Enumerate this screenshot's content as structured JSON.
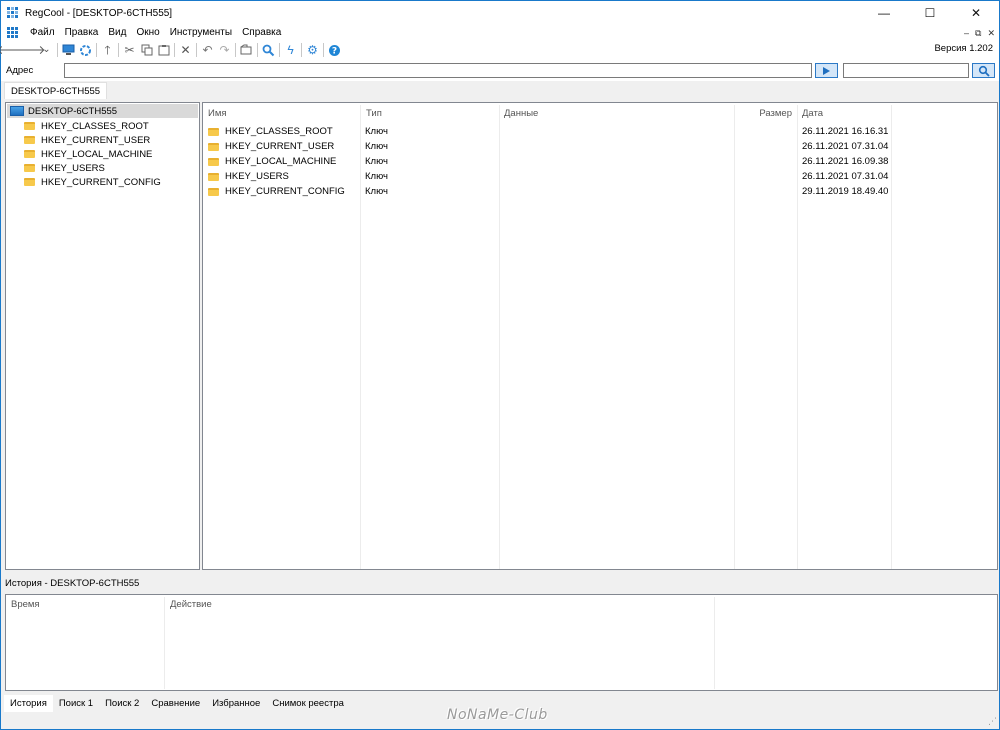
{
  "window": {
    "title": "RegCool - [DESKTOP-6CTH555]",
    "minimize": "—",
    "maximize": "☐",
    "close": "✕"
  },
  "menu": {
    "items": [
      "Файл",
      "Правка",
      "Вид",
      "Окно",
      "Инструменты",
      "Справка"
    ],
    "mdi_min": "–",
    "mdi_restore": "⧉",
    "mdi_close": "✕"
  },
  "toolbar": {
    "version": "Версия 1.202"
  },
  "address": {
    "label": "Адрес",
    "value": "",
    "search_value": ""
  },
  "tab": {
    "label": "DESKTOP-6CTH555"
  },
  "tree": {
    "root": "DESKTOP-6CTH555",
    "items": [
      "HKEY_CLASSES_ROOT",
      "HKEY_CURRENT_USER",
      "HKEY_LOCAL_MACHINE",
      "HKEY_USERS",
      "HKEY_CURRENT_CONFIG"
    ]
  },
  "list": {
    "columns": {
      "name": "Имя",
      "type": "Тип",
      "data": "Данные",
      "size": "Размер",
      "date": "Дата"
    },
    "rows": [
      {
        "name": "HKEY_CLASSES_ROOT",
        "type": "Ключ",
        "data": "",
        "size": "",
        "date": "26.11.2021 16.16.31"
      },
      {
        "name": "HKEY_CURRENT_USER",
        "type": "Ключ",
        "data": "",
        "size": "",
        "date": "26.11.2021 07.31.04"
      },
      {
        "name": "HKEY_LOCAL_MACHINE",
        "type": "Ключ",
        "data": "",
        "size": "",
        "date": "26.11.2021 16.09.38"
      },
      {
        "name": "HKEY_USERS",
        "type": "Ключ",
        "data": "",
        "size": "",
        "date": "26.11.2021 07.31.04"
      },
      {
        "name": "HKEY_CURRENT_CONFIG",
        "type": "Ключ",
        "data": "",
        "size": "",
        "date": "29.11.2019 18.49.40"
      }
    ]
  },
  "history": {
    "title": "История - DESKTOP-6CTH555",
    "col_time": "Время",
    "col_action": "Действие"
  },
  "bottom_tabs": [
    "История",
    "Поиск 1",
    "Поиск 2",
    "Сравнение",
    "Избранное",
    "Снимок реестра"
  ],
  "watermark": "NoNaMe-Club",
  "colors": {
    "accent": "#1979ca",
    "folder": "#f7c94b",
    "selection": "#d9d9d9"
  }
}
